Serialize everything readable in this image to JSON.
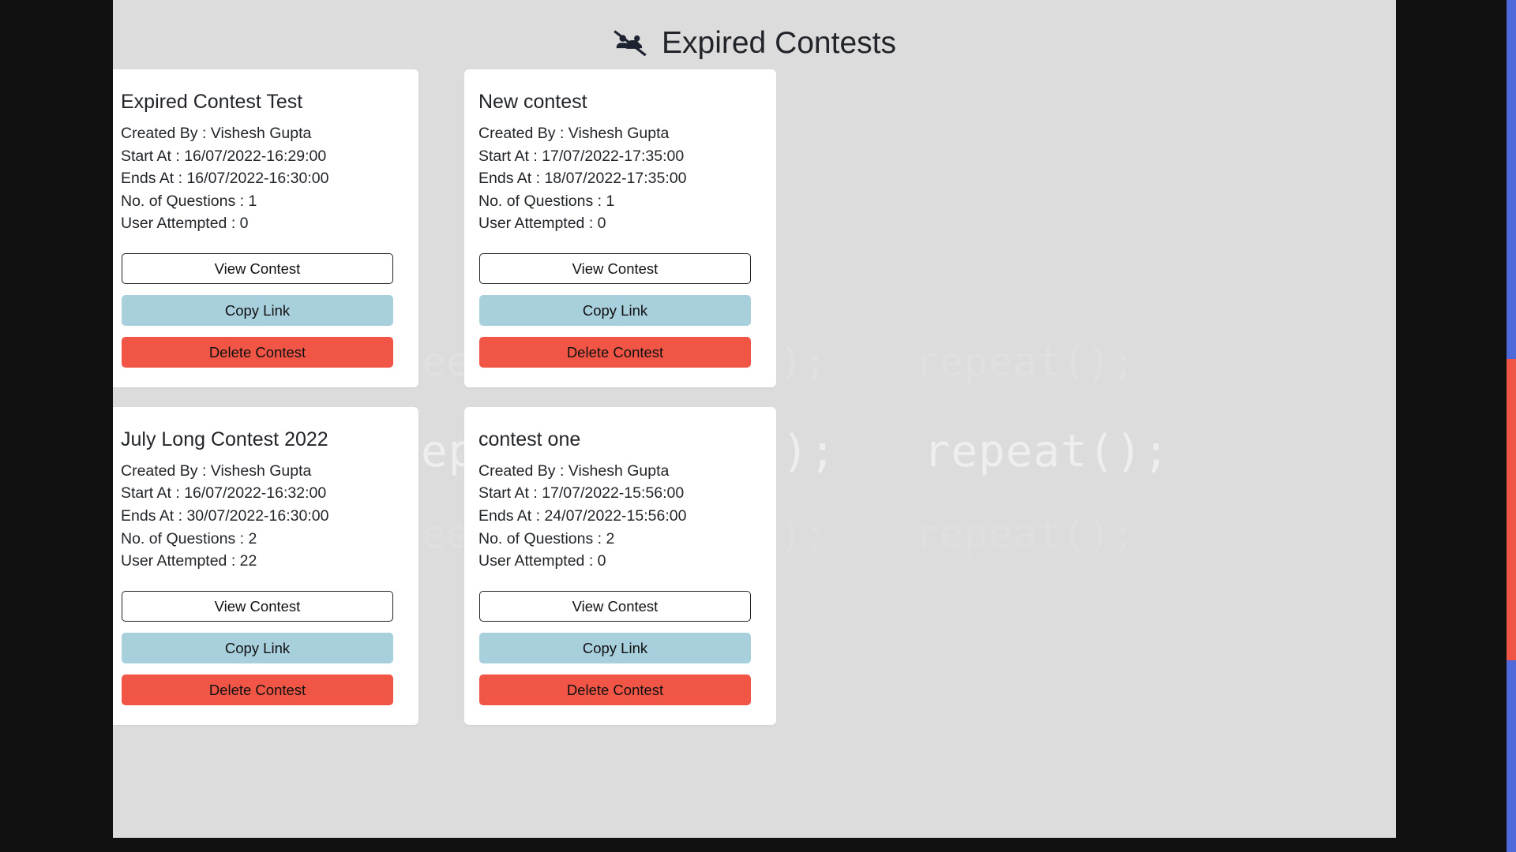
{
  "header": {
    "title": "Expired Contests",
    "icon": "users-slash-icon"
  },
  "background": {
    "watermark_row_a": [
      "sleep();",
      "code();",
      "repeat();"
    ],
    "watermark_row_b": [
      "sleep();",
      "code();",
      "repeat();"
    ],
    "watermark_row_c": [
      "sleep();",
      "code();",
      "repeat();"
    ]
  },
  "labels": {
    "created_by": "Created By :",
    "start_at": "Start At :",
    "ends_at": "Ends At :",
    "questions": "No. of Questions :",
    "attempted": "User Attempted :",
    "view": "View Contest",
    "copy": "Copy Link",
    "delete": "Delete Contest"
  },
  "colors": {
    "page_background": "#dcdcdc",
    "card_background": "#ffffff",
    "copy_button": "#a8cfdc",
    "delete_button": "#f05545",
    "accent_blue": "#4f6ad8",
    "frame": "#111111"
  },
  "cards": [
    {
      "title": "Expired Contest Test",
      "created_by": "Created By : Vishesh Gupta",
      "start_at": "Start At : 16/07/2022-16:29:00",
      "ends_at": "Ends At : 16/07/2022-16:30:00",
      "questions": "No. of Questions : 1",
      "attempted": "User Attempted : 0",
      "view_label": "View Contest",
      "copy_label": "Copy Link",
      "delete_label": "Delete Contest"
    },
    {
      "title": "New contest",
      "created_by": "Created By : Vishesh Gupta",
      "start_at": "Start At : 17/07/2022-17:35:00",
      "ends_at": "Ends At : 18/07/2022-17:35:00",
      "questions": "No. of Questions : 1",
      "attempted": "User Attempted : 0",
      "view_label": "View Contest",
      "copy_label": "Copy Link",
      "delete_label": "Delete Contest"
    },
    {
      "title": "July Long Contest 2022",
      "created_by": "Created By : Vishesh Gupta",
      "start_at": "Start At : 16/07/2022-16:32:00",
      "ends_at": "Ends At : 30/07/2022-16:30:00",
      "questions": "No. of Questions : 2",
      "attempted": "User Attempted : 22",
      "view_label": "View Contest",
      "copy_label": "Copy Link",
      "delete_label": "Delete Contest"
    },
    {
      "title": "contest one",
      "created_by": "Created By : Vishesh Gupta",
      "start_at": "Start At : 17/07/2022-15:56:00",
      "ends_at": "Ends At : 24/07/2022-15:56:00",
      "questions": "No. of Questions : 2",
      "attempted": "User Attempted : 0",
      "view_label": "View Contest",
      "copy_label": "Copy Link",
      "delete_label": "Delete Contest"
    }
  ]
}
